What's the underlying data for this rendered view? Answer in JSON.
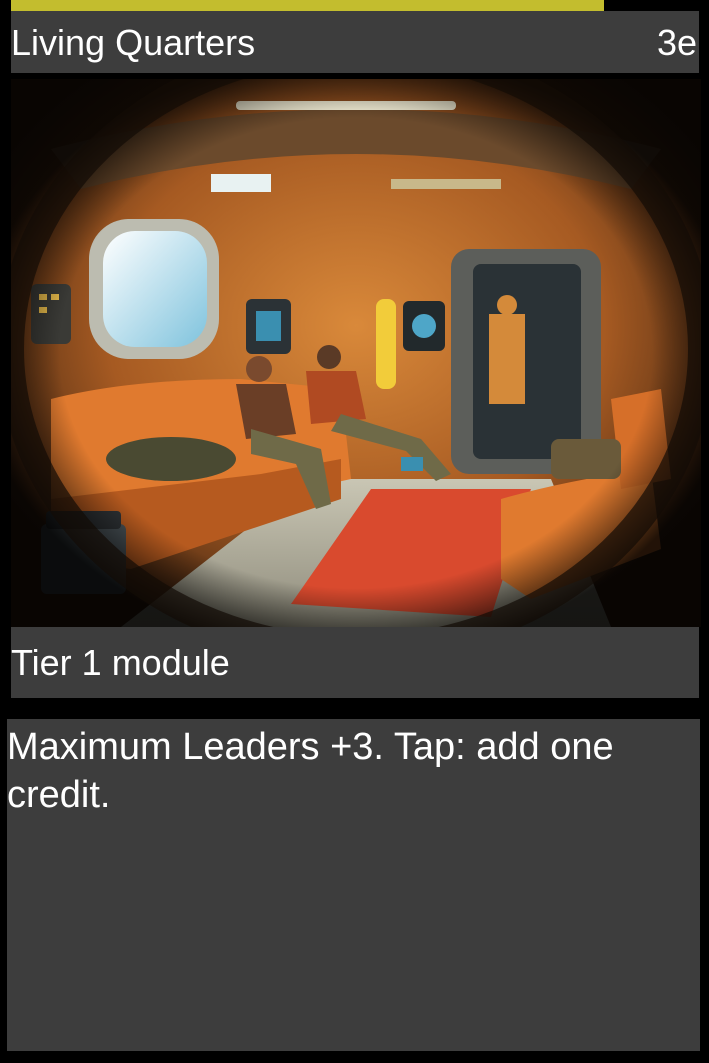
{
  "card": {
    "title": "Living Quarters",
    "cost": "3e",
    "type_line": "Tier 1 module",
    "rules_text": "Maximum Leaders +3. Tap: add one credit.",
    "accent_color": "#c3bd2e",
    "panel_color": "#3d3d3d"
  },
  "art": {
    "subject": "spaceship-living-quarters-illustration"
  }
}
